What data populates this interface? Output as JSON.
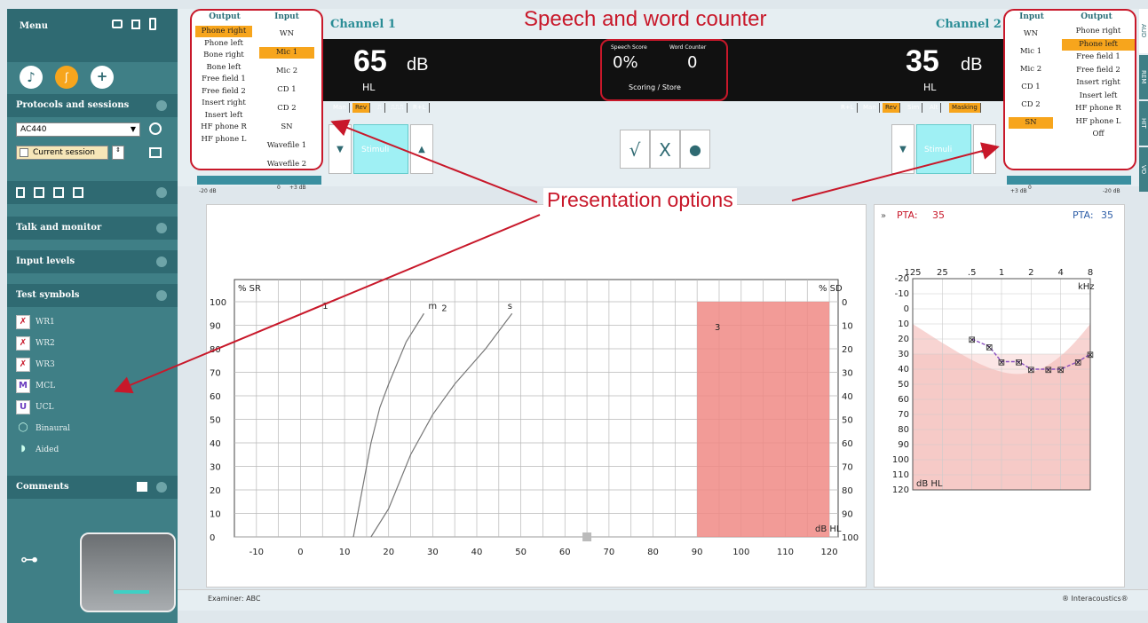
{
  "annotations": {
    "title": "Speech and word counter",
    "presentation": "Presentation options",
    "n1": "1",
    "n2": "2",
    "n3": "3"
  },
  "sidebar": {
    "menu_label": "Menu",
    "protocols_label": "Protocols and sessions",
    "protocol_value": "AC440",
    "current_session_label": "Current session",
    "talk_monitor_label": "Talk and monitor",
    "input_levels_label": "Input levels",
    "test_symbols_label": "Test symbols",
    "symbols": [
      {
        "label": "WR1",
        "icon": "wr1-icon",
        "glyph": "✗"
      },
      {
        "label": "WR2",
        "icon": "wr2-icon",
        "glyph": "✗"
      },
      {
        "label": "WR3",
        "icon": "wr3-icon",
        "glyph": "✗"
      },
      {
        "label": "MCL",
        "icon": "mcl-icon",
        "glyph": "M"
      },
      {
        "label": "UCL",
        "icon": "ucl-icon",
        "glyph": "U"
      },
      {
        "label": "Binaural",
        "icon": "binaural-icon",
        "glyph": "◯"
      },
      {
        "label": "Aided",
        "icon": "aided-icon",
        "glyph": "◗"
      }
    ],
    "comments_label": "Comments"
  },
  "left_options": {
    "output_header": "Output",
    "input_header": "Input",
    "outputs": [
      "Phone right",
      "Phone left",
      "Bone right",
      "Bone left",
      "Free field 1",
      "Free field 2",
      "Insert right",
      "Insert left",
      "HF phone R",
      "HF phone L"
    ],
    "inputs": [
      "WN",
      "Mic 1",
      "Mic 2",
      "CD 1",
      "CD 2",
      "SN",
      "Wavefile 1",
      "Wavefile 2"
    ],
    "selected_output": "Phone right",
    "selected_input": "Mic 1"
  },
  "right_options": {
    "input_header": "Input",
    "output_header": "Output",
    "inputs": [
      "WN",
      "Mic 1",
      "Mic 2",
      "CD 1",
      "CD 2",
      "SN"
    ],
    "outputs": [
      "Phone right",
      "Phone left",
      "Free field 1",
      "Free field 2",
      "Insert right",
      "Insert left",
      "HF phone R",
      "HF phone L",
      "Off"
    ],
    "selected_input": "SN",
    "selected_output": "Phone left"
  },
  "channel1": {
    "title": "Channel 1",
    "level": "65",
    "unit": "dB",
    "scale": "HL",
    "buttons": [
      "Man",
      "Rev",
      "⎍",
      "⎍⎍⎍",
      "R+L"
    ],
    "stimuli_label": "Stimuli",
    "slider_min": "-20 dB",
    "slider_mid1": "0",
    "slider_mid2": "+3 dB"
  },
  "channel2": {
    "title": "Channel 2",
    "level": "35",
    "unit": "dB",
    "scale": "HL",
    "buttons": [
      "R+L",
      "Man",
      "Rev",
      "Sim",
      "Alt",
      "Masking"
    ],
    "stimuli_label": "Stimuli",
    "slider_min": "+3 dB",
    "slider_mid": "0",
    "slider_max": "-20 dB"
  },
  "counter": {
    "speech_score_label": "Speech Score",
    "word_counter_label": "Word Counter",
    "speech_score": "0%",
    "word_counter": "0",
    "scoring_label": "Scoring / Store"
  },
  "right_tabs": [
    "AUD",
    "REM",
    "HIT",
    "VO"
  ],
  "speech_chart": {
    "left_axis_label": "% SR",
    "right_axis_label": "% SD",
    "x_axis_label": "dB HL",
    "m_label": "m",
    "s_label": "s",
    "left_ticks": [
      "100",
      "90",
      "80",
      "70",
      "60",
      "50",
      "40",
      "30",
      "20",
      "10",
      "0"
    ],
    "right_ticks": [
      "0",
      "10",
      "20",
      "30",
      "40",
      "50",
      "60",
      "70",
      "80",
      "90",
      "100"
    ],
    "x_ticks": [
      "-10",
      "0",
      "10",
      "20",
      "30",
      "40",
      "50",
      "60",
      "70",
      "80",
      "90",
      "100",
      "110",
      "120"
    ]
  },
  "chart_data": [
    {
      "type": "line",
      "title": "",
      "xlabel": "dB HL",
      "ylabel": "% SR",
      "xlim": [
        -15,
        122
      ],
      "ylim": [
        0,
        100
      ],
      "series": [
        {
          "name": "m",
          "x": [
            12,
            14,
            16,
            18,
            20,
            24,
            28
          ],
          "y": [
            0,
            20,
            40,
            55,
            65,
            83,
            95
          ]
        },
        {
          "name": "s",
          "x": [
            16,
            20,
            25,
            30,
            35,
            42,
            48
          ],
          "y": [
            0,
            12,
            35,
            52,
            65,
            80,
            95
          ]
        }
      ],
      "shaded_region": {
        "x": [
          90,
          120
        ],
        "y": [
          0,
          100
        ],
        "color": "#f08a85"
      },
      "marker": {
        "x": 65,
        "y": 0
      }
    },
    {
      "type": "line",
      "title": "",
      "xlabel": "kHz",
      "ylabel": "dB HL",
      "pta_left_label": "PTA:",
      "pta_left_value": "35",
      "pta_right_label": "PTA:",
      "pta_right_value": "35",
      "freq_labels": [
        "125",
        "25",
        ".5",
        "1",
        "2",
        "4",
        "8"
      ],
      "y_ticks": [
        "-20",
        "-10",
        "0",
        "10",
        "20",
        "30",
        "40",
        "50",
        "60",
        "70",
        "80",
        "90",
        "100",
        "110",
        "120"
      ],
      "series": [
        {
          "x": [
            0.5,
            0.75,
            1,
            1.5,
            2,
            3,
            4,
            6,
            8
          ],
          "y": [
            20,
            25,
            35,
            35,
            40,
            40,
            40,
            35,
            30
          ]
        }
      ],
      "ylim": [
        -20,
        120
      ]
    }
  ],
  "footer": {
    "examiner": "Examiner: ABC",
    "brand": "® Interacoustics®"
  },
  "colors": {
    "accent": "#f7a51c",
    "annotation": "#c8182a",
    "sidebar": "#3f7f86",
    "shade": "#f08a85",
    "curve": "#8a4fbf"
  }
}
